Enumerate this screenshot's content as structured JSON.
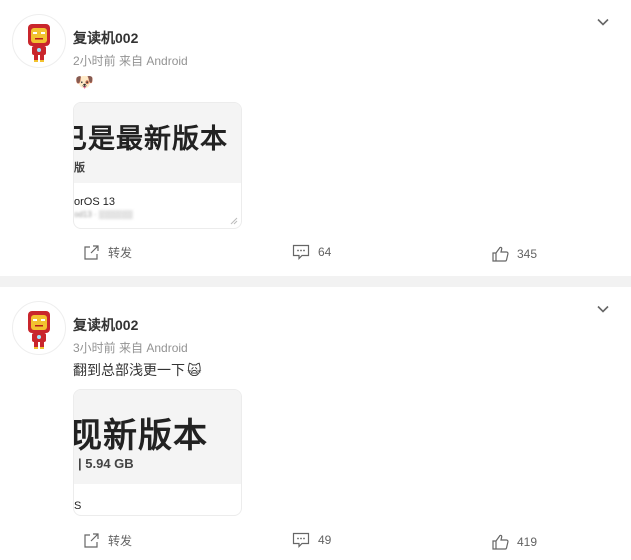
{
  "posts": [
    {
      "author": "复读机002",
      "meta": "2小时前  来自 Android",
      "text": "",
      "emoji": "🐶",
      "card": {
        "title": "已是最新版本",
        "subtitle": "版",
        "os": "orOS 13",
        "blurred": "od13 · ▒▒▒▒▒▒"
      },
      "actions": {
        "repost": "转发",
        "comments": "64",
        "likes": "345"
      }
    },
    {
      "author": "复读机002",
      "meta": "3小时前  来自 Android",
      "text": "翻到总部浅更一下",
      "emoji": "🙀",
      "card": {
        "title": "现新版本",
        "subtitle": "|  5.94 GB",
        "os": "S",
        "blurred": ""
      },
      "actions": {
        "repost": "转发",
        "comments": "49",
        "likes": "419"
      }
    }
  ],
  "icons": {
    "avatar": "iron-man-avatar",
    "more": "chevron-down-icon",
    "repost": "share-icon",
    "comment": "comment-icon",
    "like": "thumbs-up-icon"
  },
  "colors": {
    "text_primary": "#333333",
    "text_secondary": "#939393",
    "divider": "#f2f2f2"
  }
}
